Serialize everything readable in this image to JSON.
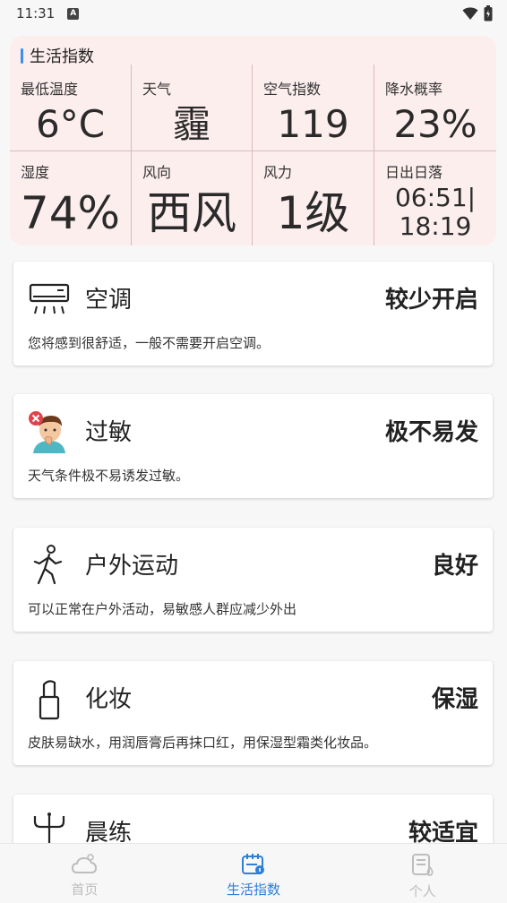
{
  "status_bar": {
    "time": "11:31",
    "a_badge": "A"
  },
  "index_panel": {
    "title": "生活指数",
    "cells": [
      {
        "label": "最低温度",
        "value": "6°C"
      },
      {
        "label": "天气",
        "value": "霾"
      },
      {
        "label": "空气指数",
        "value": "119"
      },
      {
        "label": "降水概率",
        "value": "23%"
      },
      {
        "label": "湿度",
        "value": "74%"
      },
      {
        "label": "风向",
        "value": "西风"
      },
      {
        "label": "风力",
        "value": "1级"
      },
      {
        "label": "日出日落",
        "value_line1": "06:51|",
        "value_line2": "18:19"
      }
    ]
  },
  "cards": [
    {
      "title": "空调",
      "level": "较少开启",
      "desc": "您将感到很舒适，一般不需要开启空调。",
      "icon": "air-conditioner-icon"
    },
    {
      "title": "过敏",
      "level": "极不易发",
      "desc": "天气条件极不易诱发过敏。",
      "icon": "allergy-icon"
    },
    {
      "title": "户外运动",
      "level": "良好",
      "desc": "可以正常在户外活动，易敏感人群应减少外出",
      "icon": "running-person-icon"
    },
    {
      "title": "化妆",
      "level": "保湿",
      "desc": "皮肤易缺水，用润唇膏后再抹口红，用保湿型霜类化妆品。",
      "icon": "lipstick-icon"
    },
    {
      "title": "晨练",
      "level": "较适宜",
      "desc": "",
      "icon": "exercise-icon"
    }
  ],
  "bottom_nav": [
    {
      "label": "首页",
      "icon": "weather-home-icon",
      "active": false
    },
    {
      "label": "生活指数",
      "icon": "calendar-index-icon",
      "active": true
    },
    {
      "label": "个人",
      "icon": "profile-doc-icon",
      "active": false
    }
  ],
  "colors": {
    "accent": "#2f7fd8",
    "panel_bg": "#fdeeee",
    "inactive": "#bdbdbd"
  }
}
